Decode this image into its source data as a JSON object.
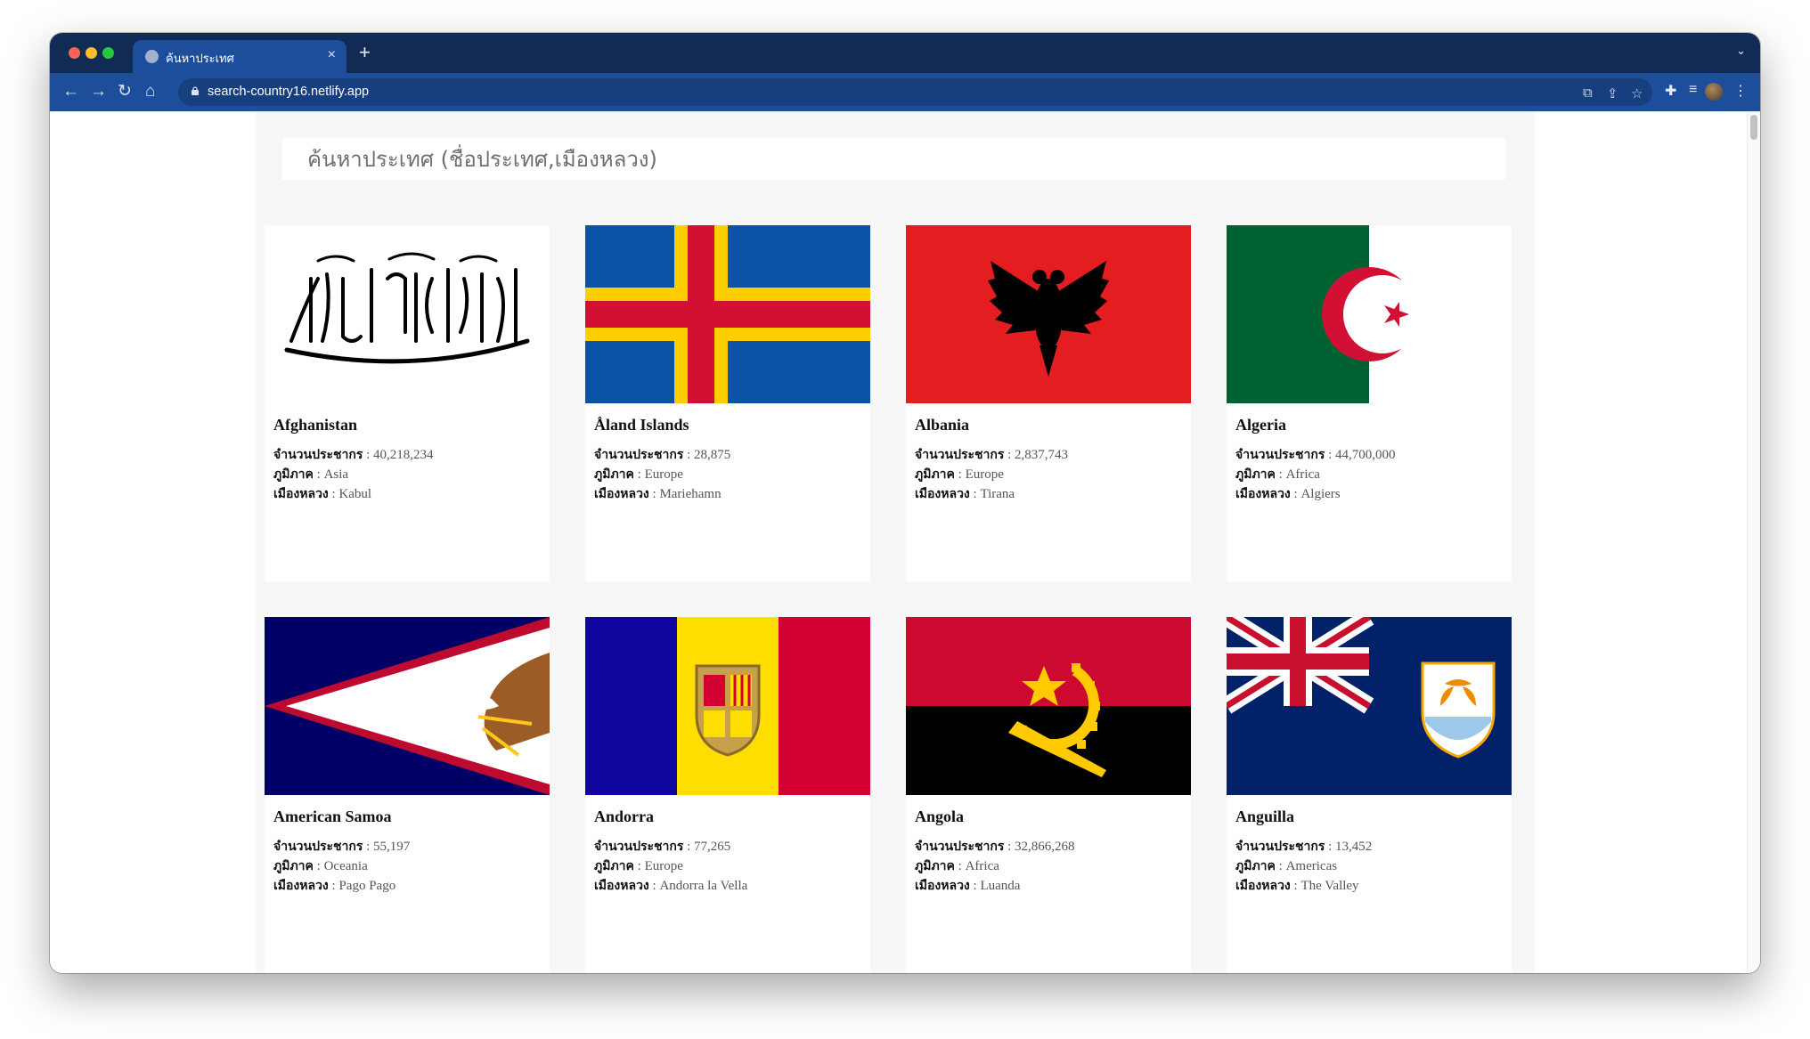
{
  "browser": {
    "tab_title": "ค้นหาประเทศ",
    "url": "search-country16.netlify.app",
    "tab_close": "×",
    "new_tab": "+",
    "tabs_menu": "⌄"
  },
  "search": {
    "placeholder": "ค้นหาประเทศ (ชื่อประเทศ,เมืองหลวง)"
  },
  "labels": {
    "population": "จำนวนประชากร",
    "region": "ภูมิภาค",
    "capital": "เมืองหลวง",
    "separator": " : "
  },
  "countries": [
    {
      "name": "Afghanistan",
      "population": "40,218,234",
      "region": "Asia",
      "capital": "Kabul",
      "flag_icon": "afghanistan-flag-icon"
    },
    {
      "name": "Åland Islands",
      "population": "28,875",
      "region": "Europe",
      "capital": "Mariehamn",
      "flag_icon": "aland-islands-flag-icon"
    },
    {
      "name": "Albania",
      "population": "2,837,743",
      "region": "Europe",
      "capital": "Tirana",
      "flag_icon": "albania-flag-icon"
    },
    {
      "name": "Algeria",
      "population": "44,700,000",
      "region": "Africa",
      "capital": "Algiers",
      "flag_icon": "algeria-flag-icon"
    },
    {
      "name": "American Samoa",
      "population": "55,197",
      "region": "Oceania",
      "capital": "Pago Pago",
      "flag_icon": "american-samoa-flag-icon"
    },
    {
      "name": "Andorra",
      "population": "77,265",
      "region": "Europe",
      "capital": "Andorra la Vella",
      "flag_icon": "andorra-flag-icon"
    },
    {
      "name": "Angola",
      "population": "32,866,268",
      "region": "Africa",
      "capital": "Luanda",
      "flag_icon": "angola-flag-icon"
    },
    {
      "name": "Anguilla",
      "population": "13,452",
      "region": "Americas",
      "capital": "The Valley",
      "flag_icon": "anguilla-flag-icon"
    }
  ],
  "colors": {
    "chrome_tabbar": "#122b55",
    "chrome_toolbar": "#1d4e9b",
    "page_bg": "#f7f7f7",
    "card_bg": "#ffffff"
  }
}
